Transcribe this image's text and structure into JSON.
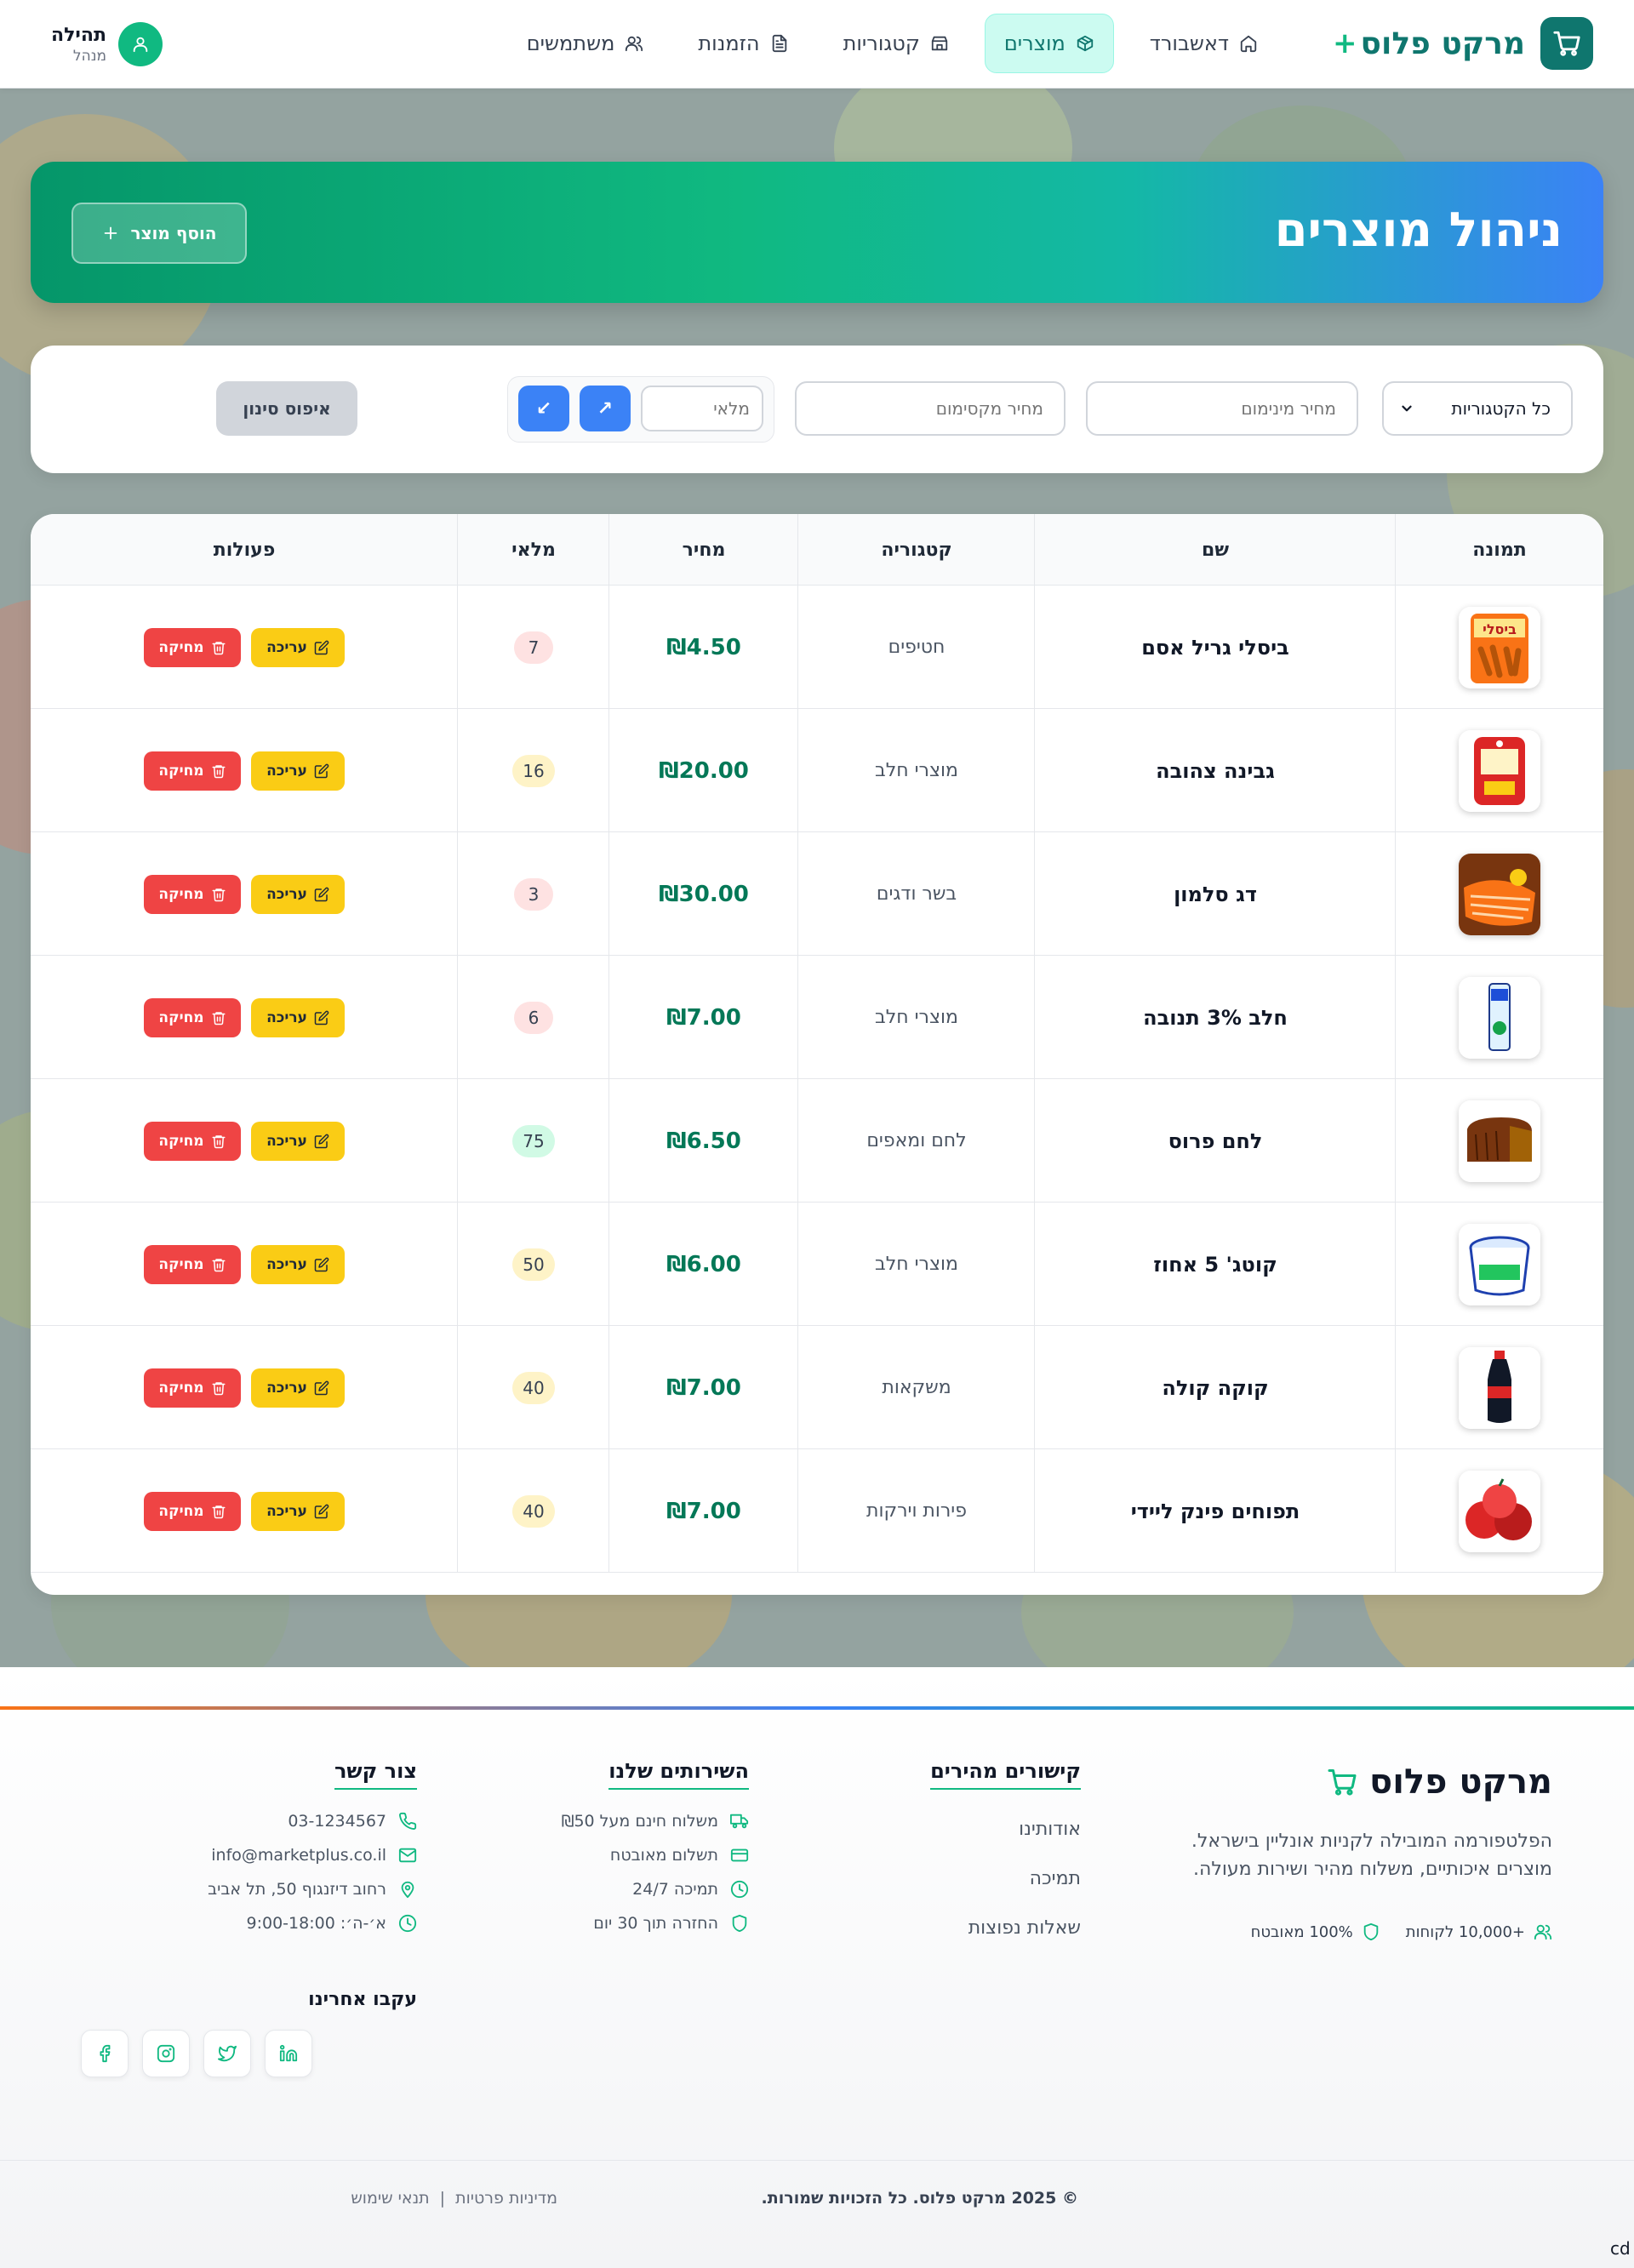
{
  "nav": {
    "brand": "מרקט פלוס",
    "brand_plus": "+",
    "links": [
      {
        "label": "דאשבורד"
      },
      {
        "label": "מוצרים"
      },
      {
        "label": "קטגוריות"
      },
      {
        "label": "הזמנות"
      },
      {
        "label": "משתמשים"
      }
    ],
    "user_name": "תהילה",
    "user_role": "מנהל"
  },
  "hero": {
    "title": "ניהול מוצרים",
    "add_label": "הוסף מוצר"
  },
  "filters": {
    "category_value": "כל הקטגוריות",
    "min_price_placeholder": "מחיר מינימום",
    "max_price_placeholder": "מחיר מקסימום",
    "stock_placeholder": "מלאי",
    "sort_up": "↗",
    "sort_down": "↙",
    "reset_label": "איפוס סינון"
  },
  "table": {
    "headers": {
      "image": "תמונה",
      "name": "שם",
      "category": "קטגוריה",
      "price": "מחיר",
      "stock": "מלאי",
      "actions": "פעולות"
    },
    "edit_label": "עריכה",
    "delete_label": "מחיקה",
    "rows": [
      {
        "name": "ביסלי גריל אסם",
        "category": "חטיפים",
        "price": "₪4.50",
        "stock": "7",
        "stock_color": "#fee2e2",
        "image": "bisli"
      },
      {
        "name": "גבינה צהובה",
        "category": "מוצרי חלב",
        "price": "₪20.00",
        "stock": "16",
        "stock_color": "#fef3c7",
        "image": "cheese"
      },
      {
        "name": "דג סלמון",
        "category": "בשר ודגים",
        "price": "₪30.00",
        "stock": "3",
        "stock_color": "#fee2e2",
        "image": "salmon"
      },
      {
        "name": "חלב 3% תנובה",
        "category": "מוצרי חלב",
        "price": "₪7.00",
        "stock": "6",
        "stock_color": "#fee2e2",
        "image": "milk"
      },
      {
        "name": "לחם פרוס",
        "category": "לחם ומאפים",
        "price": "₪6.50",
        "stock": "75",
        "stock_color": "#d1fae5",
        "image": "bread"
      },
      {
        "name": "קוטג' 5 אחוז",
        "category": "מוצרי חלב",
        "price": "₪6.00",
        "stock": "50",
        "stock_color": "#fef3c7",
        "image": "cottage"
      },
      {
        "name": "קוקה קולה",
        "category": "משקאות",
        "price": "₪7.00",
        "stock": "40",
        "stock_color": "#fef3c7",
        "image": "cola"
      },
      {
        "name": "תפוחים פינק ליידי",
        "category": "פירות וירקות",
        "price": "₪7.00",
        "stock": "40",
        "stock_color": "#fef3c7",
        "image": "apples"
      }
    ]
  },
  "footer": {
    "brand": "מרקט פלוס",
    "desc_line1": "הפלטפורמה המובילה לקניות אונליין בישראל.",
    "desc_line2": "מוצרים איכותיים, משלוח מהיר ושירות מעולה.",
    "stat_customers": "+10,000 לקוחות",
    "stat_secure": "100% מאובטח",
    "quick_links_title": "קישורים מהירים",
    "quick_links": [
      "אודותינו",
      "תמיכה",
      "שאלות נפוצות"
    ],
    "services_title": "השירותים שלנו",
    "services": [
      "משלוח חינם מעל ₪50",
      "תשלום מאובטח",
      "תמיכה 24/7",
      "החזרה תוך 30 יום"
    ],
    "contact_title": "צור קשר",
    "contact": [
      "03-1234567",
      "info@marketplus.co.il",
      "רחוב דיזנגוף 50, תל אביב",
      "א׳-ה׳: 9:00-18:00"
    ],
    "follow_title": "עקבו אחרינו",
    "social": [
      "linkedin-icon",
      "twitter-icon",
      "instagram-icon",
      "facebook-icon"
    ],
    "copyright": "© 2025 מרקט פלוס. כל הזכויות שמורות.",
    "privacy": "מדיניות פרטיות",
    "separator": "|",
    "terms": "תנאי שימוש"
  },
  "corner_text": "cd",
  "colors": {
    "brand": "#0f766e",
    "accent": "#10b981",
    "price": "#047857",
    "edit": "#facc15",
    "delete": "#ef4444",
    "sort": "#3b82f6"
  }
}
